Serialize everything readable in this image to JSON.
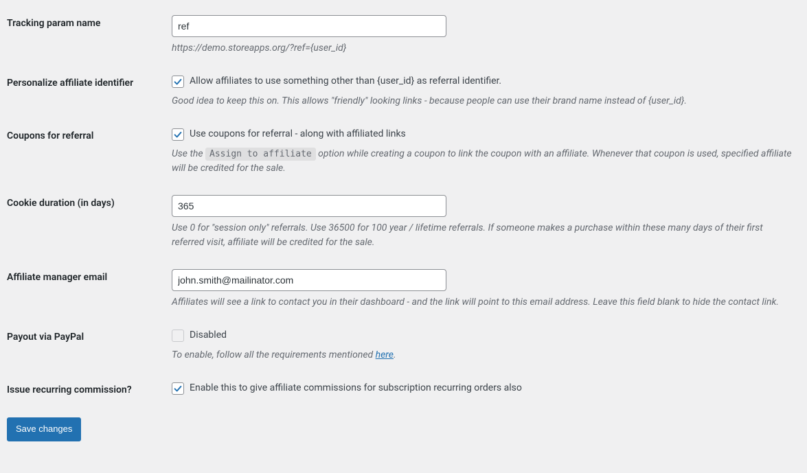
{
  "fields": {
    "tracking_param": {
      "label": "Tracking param name",
      "value": "ref",
      "hint": "https://demo.storeapps.org/?ref={user_id}"
    },
    "personalize": {
      "label": "Personalize affiliate identifier",
      "checkbox_label": "Allow affiliates to use something other than {user_id} as referral identifier.",
      "hint": "Good idea to keep this on. This allows \"friendly\" looking links - because people can use their brand name instead of {user_id}."
    },
    "coupons": {
      "label": "Coupons for referral",
      "checkbox_label": "Use coupons for referral - along with affiliated links",
      "hint_before": "Use the ",
      "hint_code": "Assign to affiliate",
      "hint_after": " option while creating a coupon to link the coupon with an affiliate. Whenever that coupon is used, specified affiliate will be credited for the sale."
    },
    "cookie": {
      "label": "Cookie duration (in days)",
      "value": "365",
      "hint": "Use 0 for \"session only\" referrals. Use 36500 for 100 year / lifetime referrals. If someone makes a purchase within these many days of their first referred visit, affiliate will be credited for the sale."
    },
    "manager_email": {
      "label": "Affiliate manager email",
      "value": "john.smith@mailinator.com",
      "hint": "Affiliates will see a link to contact you in their dashboard - and the link will point to this email address. Leave this field blank to hide the contact link."
    },
    "paypal": {
      "label": "Payout via PayPal",
      "checkbox_label": "Disabled",
      "hint_before": "To enable, follow all the requirements mentioned ",
      "hint_link": "here",
      "hint_after": "."
    },
    "recurring": {
      "label": "Issue recurring commission?",
      "checkbox_label": "Enable this to give affiliate commissions for subscription recurring orders also"
    }
  },
  "submit_label": "Save changes"
}
